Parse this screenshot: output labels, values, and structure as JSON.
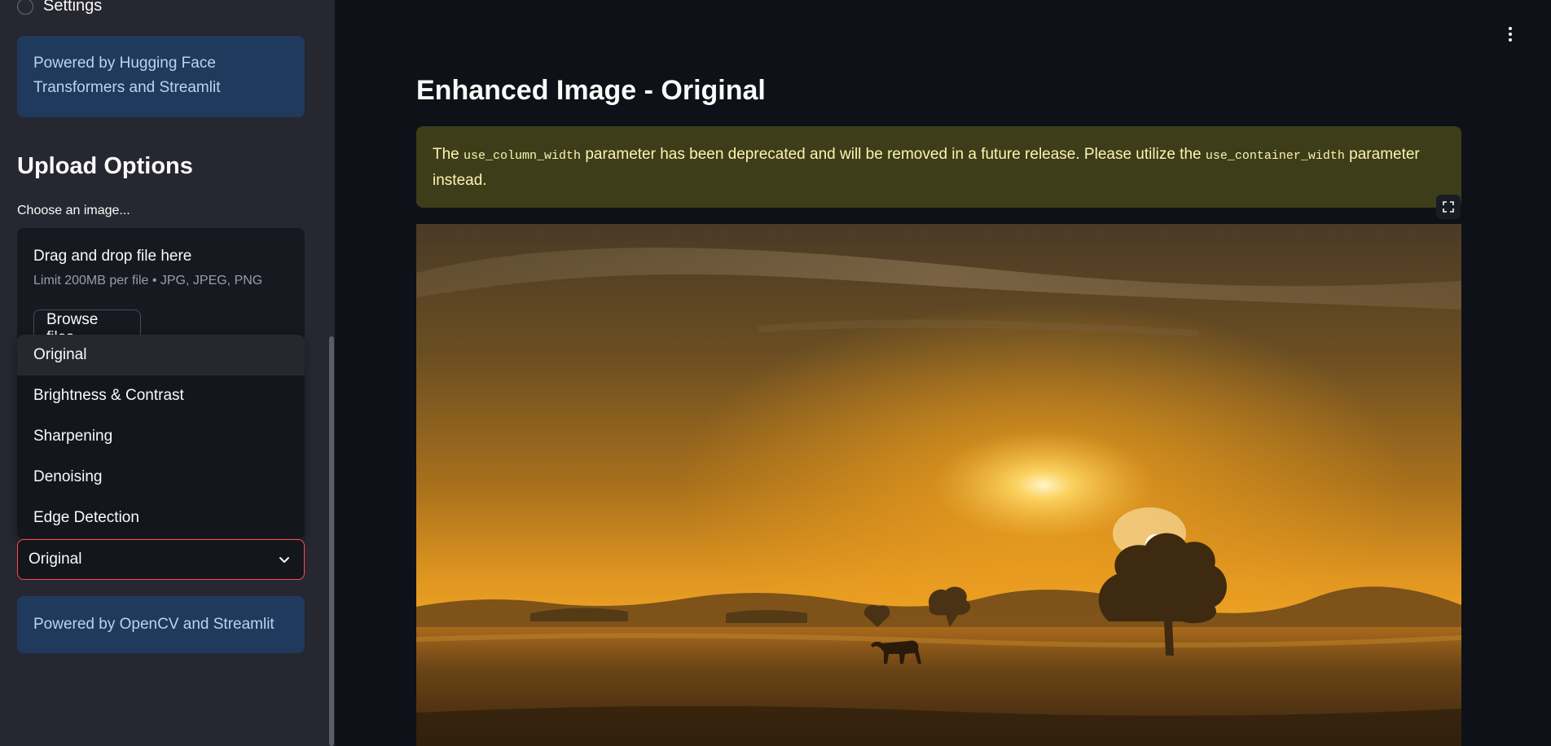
{
  "sidebar": {
    "radio_label": "Settings",
    "info_top": "Powered by Hugging Face Transformers and Streamlit",
    "section_title": "Upload Options",
    "uploader": {
      "label": "Choose an image...",
      "drop_title": "Drag and drop file here",
      "limit": "Limit 200MB per file • JPG, JPEG, PNG",
      "browse_label": "Browse files"
    },
    "dropdown": {
      "options": [
        "Original",
        "Brightness & Contrast",
        "Sharpening",
        "Denoising",
        "Edge Detection"
      ],
      "selected": "Original"
    },
    "info_bottom": "Powered by OpenCV and Streamlit"
  },
  "main": {
    "title": "Enhanced Image - Original",
    "warning": {
      "part1": "The ",
      "code1": "use_column_width",
      "part2": " parameter has been deprecated and will be removed in a future release. Please utilize the ",
      "code2": "use_container_width",
      "part3": " parameter instead."
    }
  },
  "colors": {
    "accent": "#ff4b4b",
    "sidebar_bg": "#262730",
    "main_bg": "#0e1117",
    "info_bg": "#1f3a5c",
    "warning_bg": "#3d3d1a"
  },
  "icons": {
    "kebab": "vertical-dots-icon",
    "chevron": "chevron-down-icon",
    "fullscreen": "fullscreen-icon"
  }
}
